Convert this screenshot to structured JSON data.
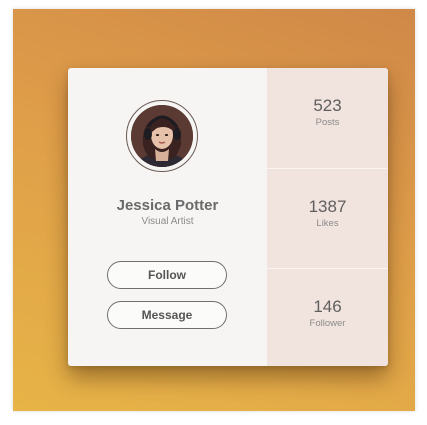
{
  "profile": {
    "name": "Jessica Potter",
    "role": "Visual Artist"
  },
  "actions": {
    "follow_label": "Follow",
    "message_label": "Message"
  },
  "stats": [
    {
      "value": "523",
      "label": "Posts"
    },
    {
      "value": "1387",
      "label": "Likes"
    },
    {
      "value": "146",
      "label": "Follower"
    }
  ],
  "colors": {
    "background_gradient_top": "#d08848",
    "background_gradient_bottom": "#e7b447",
    "card_background": "#f6f5f3",
    "stats_panel": "#f1e3de",
    "text_dark": "#5f5f5f",
    "text_muted": "#8c8c8c"
  }
}
